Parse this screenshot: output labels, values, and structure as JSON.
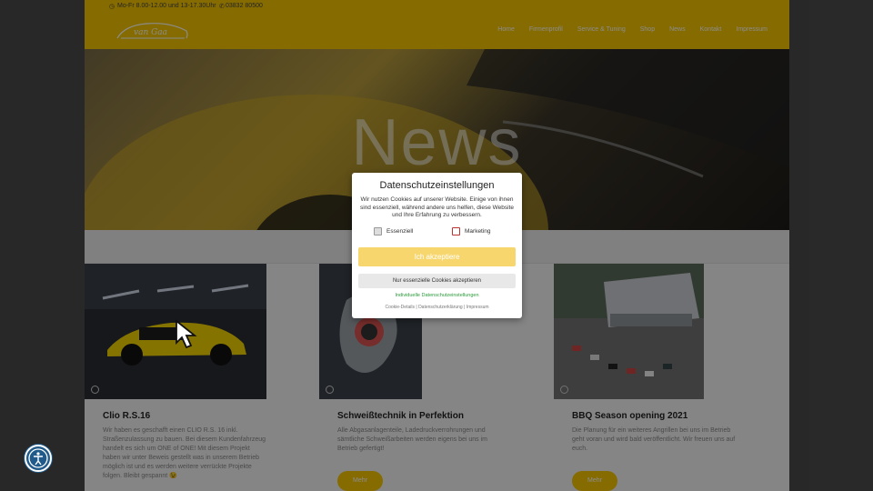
{
  "topbar": {
    "hours": "Mo-Fr 8.00-12.00 und 13-17.30Uhr",
    "phone": "03832 80500"
  },
  "header": {
    "logo_text": "van Gaa",
    "nav": [
      "Home",
      "Firmenprofil",
      "Service & Tuning",
      "Shop",
      "News",
      "Kontakt",
      "Impressum"
    ]
  },
  "hero": {
    "title": "News"
  },
  "posts": [
    {
      "title": "Clio R.S.16",
      "excerpt": "Wir haben es geschafft einen CLIO R.S. 16 inkl. Straßenzulassung zu bauen. Bei diesem Kundenfahrzeug handelt es sich um ONE of ONE! Mit diesem Projekt haben wir unter Beweis gestellt was in unserem Betrieb möglich ist und es werden weitere verrückte Projekte folgen. Bleibt gespannt 😉"
    },
    {
      "title": "Schweißtechnik in Perfektion",
      "excerpt": "Alle Abgasanlagenteile, Ladedruckverrohrungen und sämtliche Schweißarbeiten werden eigens bei uns im Betrieb gefertigt!",
      "more": "Mehr"
    },
    {
      "title": "BBQ Season opening 2021",
      "excerpt": "Die Planung für ein weiteres Angrillen bei uns im Betrieb geht voran und wird bald veröffentlicht. Wir freuen uns auf euch.",
      "more": "Mehr"
    }
  ],
  "cookie": {
    "title": "Datenschutzeinstellungen",
    "description": "Wir nutzen Cookies auf unserer Website. Einige von ihnen sind essenziell, während andere uns helfen, diese Website und Ihre Erfahrung zu verbessern.",
    "essential_label": "Essenziell",
    "marketing_label": "Marketing",
    "accept_label": "Ich akzeptiere",
    "essential_only_label": "Nur essenzielle Cookies akzeptieren",
    "individual_label": "Individuelle Datenschutzeinstellungen",
    "links": [
      "Cookie-Details",
      "Datenschutzerklärung",
      "Impressum"
    ]
  },
  "colors": {
    "brand_yellow": "#f2c300",
    "accept_button": "#f7d66e",
    "link_green": "#2c9a3b",
    "access_blue": "#1f5a8a"
  },
  "icons": [
    "clock-icon",
    "phone-icon",
    "calendar-icon",
    "check-icon",
    "cursor-arrow-icon",
    "accessibility-icon"
  ]
}
